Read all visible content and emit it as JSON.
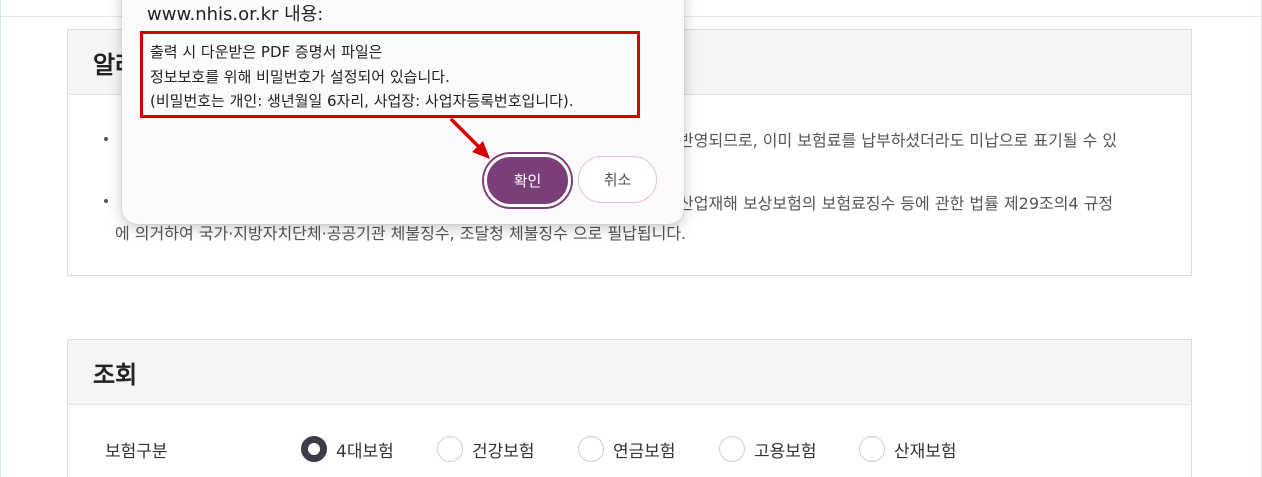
{
  "notice": {
    "title": "알려드립니다",
    "item1_line1_tail": "반영되므로, 이미 보험료를 납부하셨더라도 미납으로 표기될 수 있",
    "item2_line1_tail": "산업재해 보상보험의 보험료징수 등에 관한 법률 제29조의4 규정",
    "item2_line2": "에 의거하여 국가·지방자치단체·공공기관 체불징수, 조달청 체불징수 으로 필납됩니다."
  },
  "search": {
    "title": "조회",
    "field_label": "보험구분",
    "options": [
      "4대보험",
      "건강보험",
      "연금보험",
      "고용보험",
      "산재보험"
    ],
    "selected": "4대보험"
  },
  "dialog": {
    "origin": "www.nhis.or.kr 내용:",
    "message_lines": [
      "출력 시 다운받은 PDF 증명서 파일은",
      "정보보호를 위해 비밀번호가 설정되어 있습니다.",
      "(비밀번호는 개인: 생년월일 6자리, 사업장: 사업자등록번호입니다)."
    ],
    "confirm_label": "확인",
    "cancel_label": "취소"
  },
  "colors": {
    "confirm_button": "#7a3f78",
    "highlight_box": "#d40000",
    "arrow": "#d40000"
  },
  "icons": {
    "arrow": "red-arrow-icon"
  }
}
